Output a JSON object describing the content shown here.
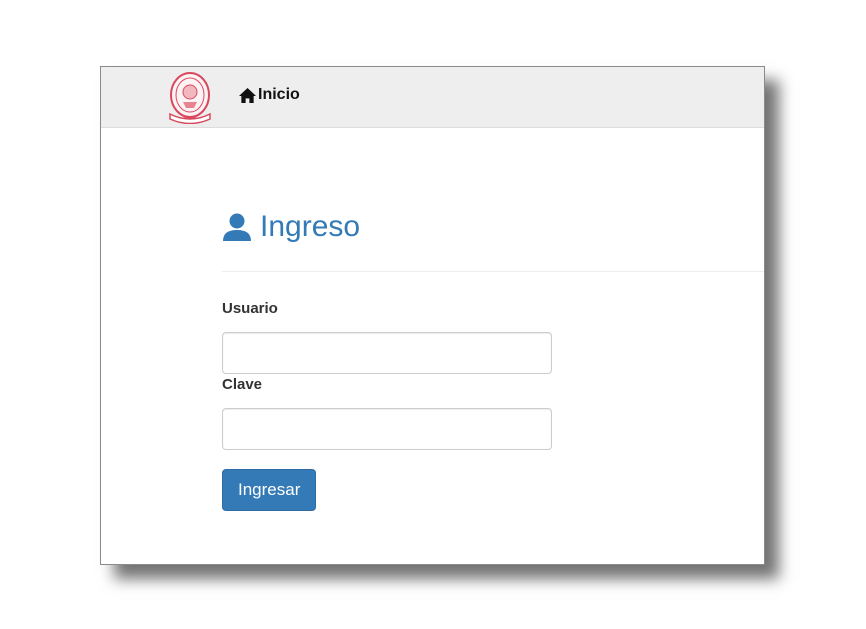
{
  "navbar": {
    "logo_icon": "university-seal-logo",
    "home_icon": "home-icon",
    "home_label": "Inicio"
  },
  "page": {
    "heading_icon": "user-icon",
    "heading": "Ingreso"
  },
  "form": {
    "username_label": "Usuario",
    "username_value": "",
    "password_label": "Clave",
    "password_value": "",
    "submit_label": "Ingresar"
  },
  "colors": {
    "primary": "#337ab7",
    "navbar_bg": "#eeeeee",
    "logo_red": "#d9485f"
  }
}
